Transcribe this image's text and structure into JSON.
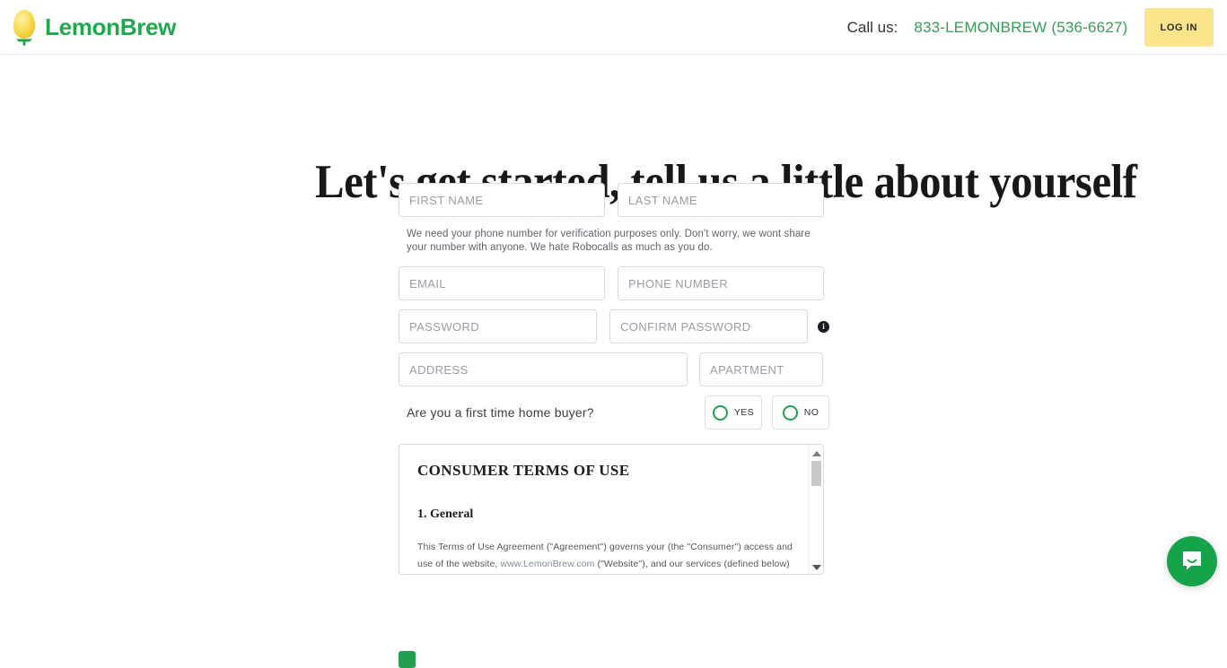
{
  "header": {
    "brand_name": "LemonBrew",
    "logo_icon": "lemon-icon",
    "call_label": "Call us:",
    "call_number": "833-LEMONBREW (536-6627)",
    "login_label": "LOG IN",
    "brand_green": "#1fa94c",
    "logo_yellow": "#f7d94c",
    "login_bg": "#fbe58a"
  },
  "main": {
    "title": "Let's get started, tell us a little about yourself",
    "fields": {
      "first_name": {
        "placeholder": "FIRST NAME",
        "value": ""
      },
      "last_name": {
        "placeholder": "LAST NAME",
        "value": ""
      },
      "email": {
        "placeholder": "EMAIL",
        "value": ""
      },
      "phone": {
        "placeholder": "PHONE NUMBER",
        "value": ""
      },
      "password": {
        "placeholder": "PASSWORD",
        "value": ""
      },
      "confirm_password": {
        "placeholder": "CONFIRM PASSWORD",
        "value": ""
      },
      "address": {
        "placeholder": "ADDRESS",
        "value": ""
      },
      "apartment": {
        "placeholder": "APARTMENT",
        "value": ""
      }
    },
    "helper_text": "We need your phone number for verification purposes only. Don't worry, we wont share your number with anyone. We hate Robocalls as much as you do.",
    "password_info_icon": "info-icon",
    "buyer_question": "Are you a first time home buyer?",
    "buyer_options": [
      {
        "label": "YES",
        "selected": false
      },
      {
        "label": "NO",
        "selected": false
      }
    ],
    "radio_green": "#22a04e"
  },
  "terms": {
    "heading": "CONSUMER TERMS OF USE",
    "section_heading": "1. General",
    "paragraph_line1": "This Terms of Use Agreement (\"Agreement\") governs your (the \"Consumer\") access and",
    "paragraph_line2_prefix": "use of the website, ",
    "paragraph_link": "www.LemonBrew.com",
    "paragraph_line2_suffix": " (\"Website\"), and our services (defined below)",
    "scroll_up_icon": "chevron-up-icon",
    "scroll_down_icon": "chevron-down-icon"
  },
  "chat": {
    "icon": "chat-bubble-icon",
    "color": "#16a34a"
  }
}
